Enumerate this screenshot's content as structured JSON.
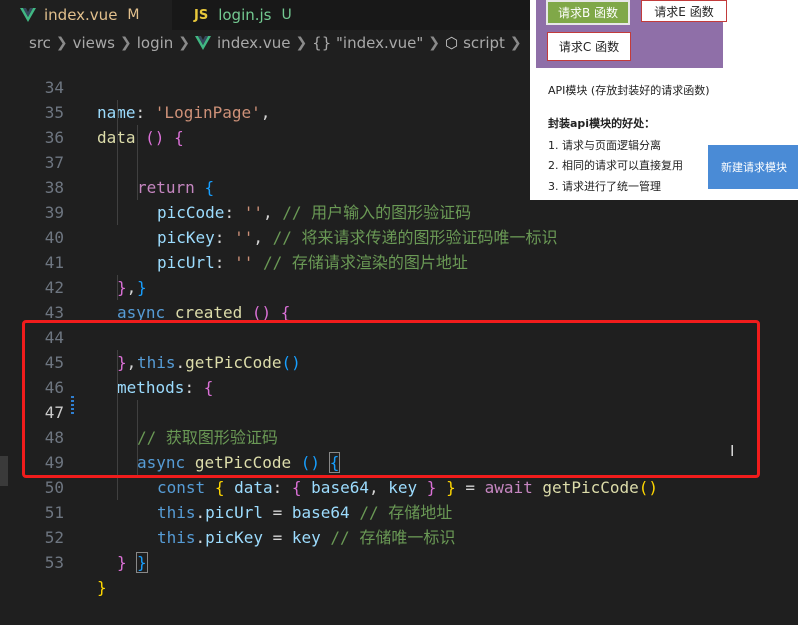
{
  "tabs": [
    {
      "label": "index.vue",
      "flag": "M",
      "icon": "vue-icon",
      "active": true
    },
    {
      "label": "login.js",
      "flag": "U",
      "icon": "js-icon",
      "icon_text": "JS",
      "active": false
    }
  ],
  "breadcrumb": [
    "src",
    "views",
    "login",
    "index.vue",
    "{} \"index.vue\"",
    "script"
  ],
  "code_lines": [
    {
      "n": "34",
      "text": "name: 'LoginPage',"
    },
    {
      "n": "35",
      "text": "data () {"
    },
    {
      "n": "36",
      "text": "return {"
    },
    {
      "n": "37",
      "text": "picCode: '', // 用户输入的图形验证码"
    },
    {
      "n": "38",
      "text": "picKey: '', // 将来请求传递的图形验证码唯一标识"
    },
    {
      "n": "39",
      "text": "picUrl: '' // 存储请求渲染的图片地址"
    },
    {
      "n": "40",
      "text": "}"
    },
    {
      "n": "41",
      "text": "},"
    },
    {
      "n": "42",
      "text": "async created () {"
    },
    {
      "n": "43",
      "text": "this.getPicCode()"
    },
    {
      "n": "44",
      "text": "},"
    },
    {
      "n": "45",
      "text": "methods: {"
    },
    {
      "n": "46",
      "text": "// 获取图形验证码"
    },
    {
      "n": "47",
      "text": "async getPicCode () {"
    },
    {
      "n": "48",
      "text": "const { data: { base64, key } } = await getPicCode()"
    },
    {
      "n": "49",
      "text": "this.picUrl = base64 // 存储地址"
    },
    {
      "n": "50",
      "text": "this.picKey = key // 存储唯一标识"
    },
    {
      "n": "51",
      "text": "}"
    },
    {
      "n": "52",
      "text": "}"
    },
    {
      "n": "53",
      "text": "}"
    }
  ],
  "current_line": "47",
  "overlay": {
    "box_b": "请求B 函数",
    "box_e": "请求E 函数",
    "box_c": "请求C 函数",
    "api_module": "API模块 (存放封装好的请求函数)",
    "benefits_title": "封装api模块的好处：",
    "benefits": [
      "1.   请求与页面逻辑分离",
      "2.   相同的请求可以直接复用",
      "3.   请求进行了统一管理"
    ],
    "new_button": "新建请求模块"
  },
  "colors": {
    "highlight": "#f01c1c",
    "button": "#4a8bd6",
    "purple": "#8f6fa8",
    "green": "#80a848"
  }
}
